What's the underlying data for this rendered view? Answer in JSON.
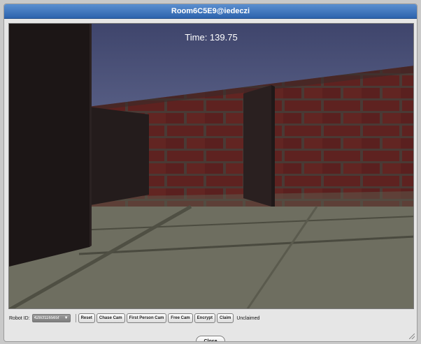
{
  "window": {
    "title": "Room6C5E9@iedeczi"
  },
  "game": {
    "time_label": "Time: 139.75"
  },
  "controls": {
    "robot_id_label": "Robot ID:",
    "robot_id_value": "428cf116565f",
    "buttons": [
      "Reset",
      "Chase Cam",
      "First Person Cam",
      "Free Cam",
      "Encrypt",
      "Claim"
    ],
    "status": "Unclaimed"
  },
  "footer": {
    "close_label": "Close"
  }
}
